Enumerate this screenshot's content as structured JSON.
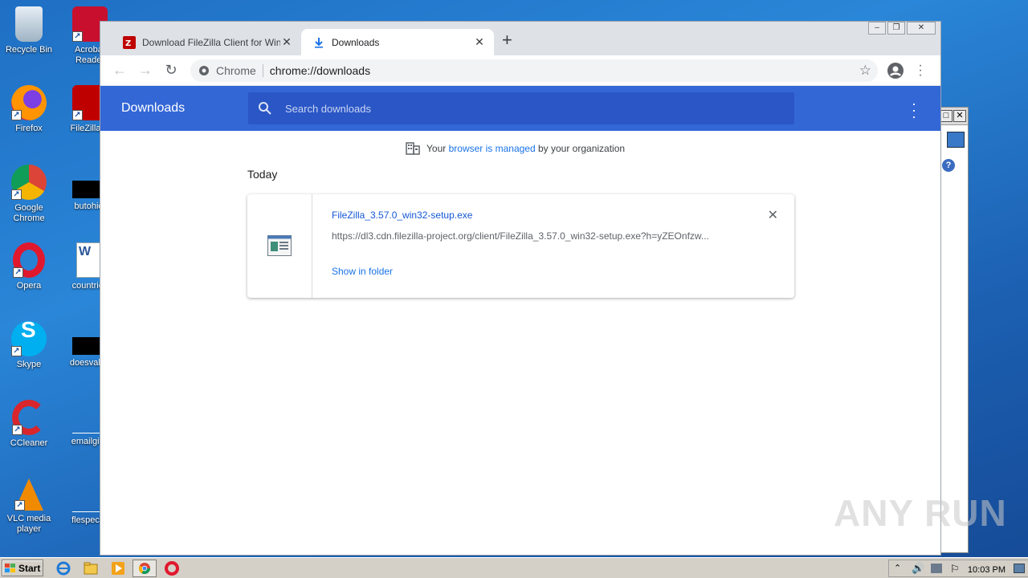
{
  "desktop": {
    "icons": [
      {
        "label": "Recycle Bin"
      },
      {
        "label": "Acrobat Reader"
      },
      {
        "label": "Firefox"
      },
      {
        "label": "FileZilla C"
      },
      {
        "label": "Google Chrome"
      },
      {
        "label": "butohio."
      },
      {
        "label": "Opera"
      },
      {
        "label": "countries"
      },
      {
        "label": "Skype"
      },
      {
        "label": "doesvalue"
      },
      {
        "label": "CCleaner"
      },
      {
        "label": "emailgive"
      },
      {
        "label": "VLC media player"
      },
      {
        "label": "flespecial"
      }
    ]
  },
  "browser": {
    "tabs": [
      {
        "title": "Download FileZilla Client for Windows",
        "icon": "filezilla-icon",
        "active": false
      },
      {
        "title": "Downloads",
        "icon": "download-icon",
        "active": true
      }
    ],
    "omnibox": {
      "chip": "Chrome",
      "url": "chrome://downloads"
    }
  },
  "downloads": {
    "header_title": "Downloads",
    "search_placeholder": "Search downloads",
    "managed": {
      "prefix": "Your ",
      "link": "browser is managed",
      "suffix": " by your organization"
    },
    "section": "Today",
    "items": [
      {
        "filename": "FileZilla_3.57.0_win32-setup.exe",
        "url": "https://dl3.cdn.filezilla-project.org/client/FileZilla_3.57.0_win32-setup.exe?h=yZEOnfzw...",
        "action": "Show in folder"
      }
    ]
  },
  "taskbar": {
    "start_label": "Start",
    "clock": "10:03 PM"
  },
  "watermark": "ANY RUN",
  "colors": {
    "header": "#3367d6",
    "search": "#2a56c6",
    "link": "#1a73e8"
  }
}
